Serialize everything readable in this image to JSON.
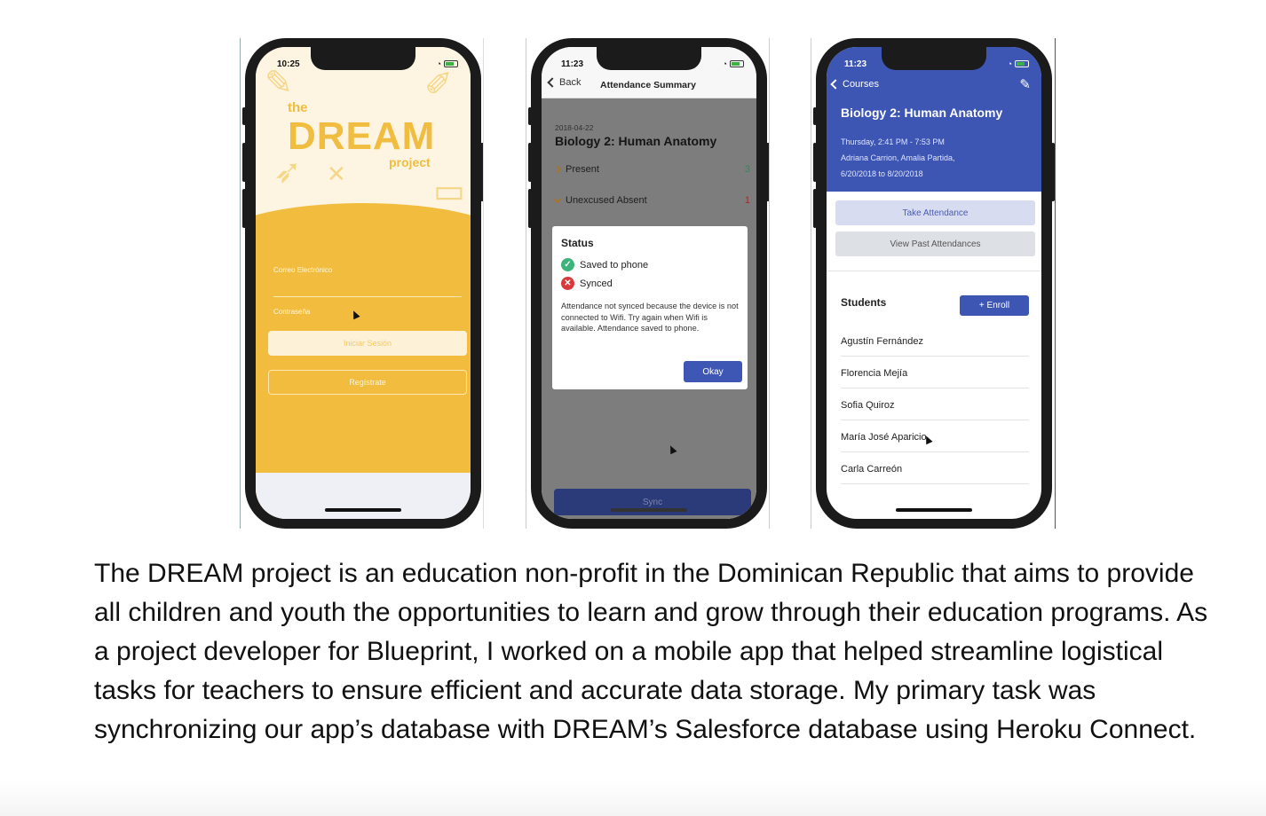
{
  "screen1": {
    "time": "10:25",
    "logo_the": "the",
    "logo_dream": "DREAM",
    "logo_project": "project",
    "email_label": "Correo Electrónico",
    "password_label": "Contraseña",
    "login_button": "Iniciar Sesión",
    "register_button": "Regístrate"
  },
  "screen2": {
    "time": "11:23",
    "back_label": "Back",
    "nav_title": "Attendance Summary",
    "date": "2018-04-22",
    "course": "Biology 2: Human Anatomy",
    "rows": [
      {
        "label": "Present",
        "count": "3"
      },
      {
        "label": "Unexcused Absent",
        "count": "1"
      }
    ],
    "modal": {
      "title": "Status",
      "items": [
        {
          "label": "Saved to phone",
          "state": "ok"
        },
        {
          "label": "Synced",
          "state": "error"
        }
      ],
      "message": "Attendance not synced because the device is not connected to Wifi. Try again when Wifi is available. Attendance saved to phone.",
      "okay_button": "Okay"
    },
    "sync_button": "Sync"
  },
  "screen3": {
    "time": "11:23",
    "back_label": "Courses",
    "title": "Biology 2: Human Anatomy",
    "schedule": "Thursday, 2:41 PM - 7:53 PM",
    "teachers": "Adriana Carrion, Amalia Partida,",
    "dates": "6/20/2018 to 8/20/2018",
    "take_attendance_button": "Take Attendance",
    "past_attendances_button": "View Past Attendances",
    "students_heading": "Students",
    "enroll_button": "+ Enroll",
    "students": [
      "Agustín Fernández",
      "Florencia Mejía",
      "Sofia Quiroz",
      "María José Aparicio",
      "Carla Carreón"
    ]
  },
  "description": "The DREAM project is an education non-profit in the Dominican Republic that aims to provide all children and youth the opportunities to learn and grow through their education programs. As a project developer for Blueprint, I worked on a mobile app that helped streamline logistical tasks for teachers to ensure efficient and accurate data storage. My primary task was synchronizing our app’s database with DREAM’s Salesforce database using Heroku Connect.",
  "colors": {
    "dream_yellow": "#f2bd3f",
    "dream_blue": "#3d55b3",
    "ok_green": "#3bb37a",
    "error_red": "#d9393b"
  }
}
